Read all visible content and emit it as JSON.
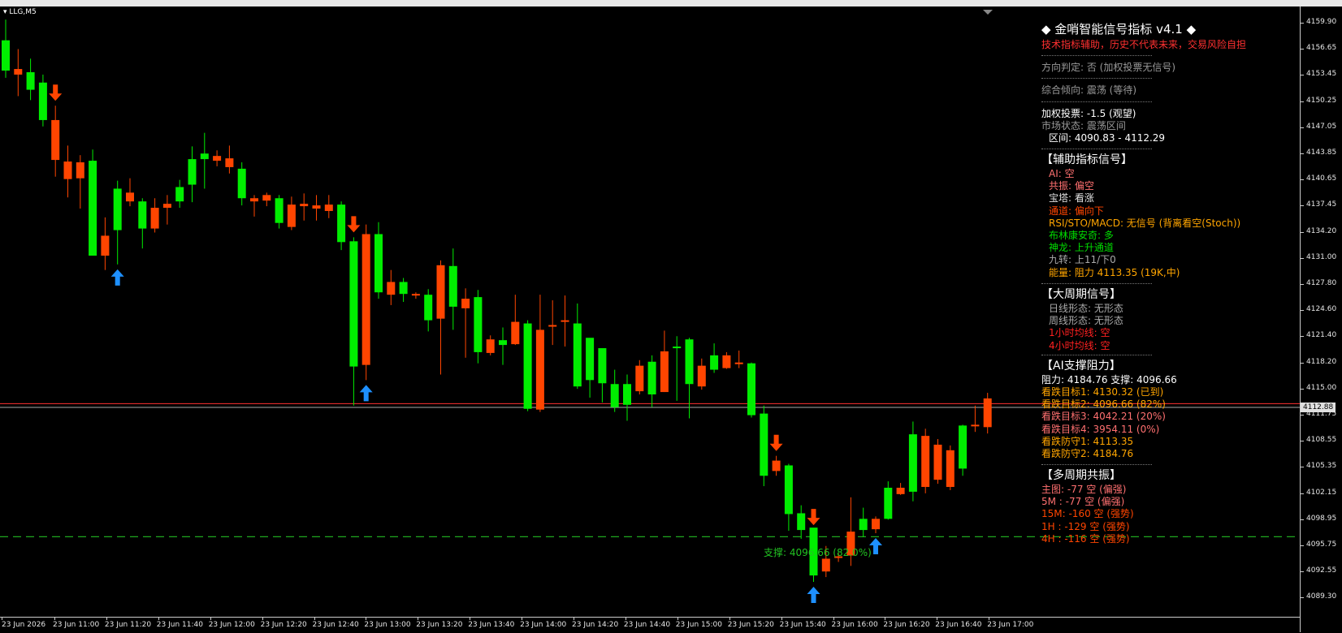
{
  "symbol": "LLG,M5",
  "colors": {
    "bull": "#00ee00",
    "bear": "#ff4500",
    "up_arrow": "#1e90ff",
    "down_arrow": "#ff4500",
    "price_line": "#ff3030",
    "support": "#1fa81f"
  },
  "price_axis": {
    "min": 4089.0,
    "max": 4161.0,
    "labels": [
      "4159.90",
      "4156.65",
      "4153.45",
      "4150.25",
      "4147.05",
      "4143.85",
      "4140.65",
      "4137.45",
      "4134.20",
      "4131.00",
      "4127.80",
      "4124.60",
      "4121.40",
      "4118.20",
      "4115.00",
      "4111.75",
      "4108.55",
      "4105.35",
      "4102.15",
      "4098.95",
      "4095.75",
      "4092.55",
      "4089.30"
    ],
    "current_price": "4112.88"
  },
  "time_axis": {
    "labels": [
      "23 Jun 2026",
      "23 Jun 11:00",
      "23 Jun 11:20",
      "23 Jun 11:40",
      "23 Jun 12:00",
      "23 Jun 12:20",
      "23 Jun 12:40",
      "23 Jun 13:00",
      "23 Jun 13:20",
      "23 Jun 13:40",
      "23 Jun 14:00",
      "23 Jun 14:20",
      "23 Jun 14:40",
      "23 Jun 15:00",
      "23 Jun 15:20",
      "23 Jun 15:40",
      "23 Jun 16:00",
      "23 Jun 16:20",
      "23 Jun 16:40",
      "23 Jun 17:00"
    ]
  },
  "chart_data": {
    "type": "candlestick",
    "candles": [
      {
        "o": 4155.1,
        "h": 4161.5,
        "l": 4154.2,
        "c": 4158.9
      },
      {
        "o": 4155.3,
        "h": 4157.8,
        "l": 4151.9,
        "c": 4154.6
      },
      {
        "o": 4152.7,
        "h": 4156.6,
        "l": 4151.4,
        "c": 4154.9
      },
      {
        "o": 4148.9,
        "h": 4154.6,
        "l": 4148.1,
        "c": 4153.6
      },
      {
        "o": 4148.9,
        "h": 4150.7,
        "l": 4141.8,
        "c": 4143.9
      },
      {
        "o": 4143.7,
        "h": 4145.7,
        "l": 4139.2,
        "c": 4141.5
      },
      {
        "o": 4143.6,
        "h": 4144.5,
        "l": 4137.8,
        "c": 4141.6
      },
      {
        "o": 4131.9,
        "h": 4145.2,
        "l": 4131.9,
        "c": 4143.8
      },
      {
        "o": 4134.4,
        "h": 4136.7,
        "l": 4130.1,
        "c": 4131.9
      },
      {
        "o": 4135.1,
        "h": 4141.3,
        "l": 4130.8,
        "c": 4140.3
      },
      {
        "o": 4139.8,
        "h": 4141.6,
        "l": 4138.1,
        "c": 4138.7
      },
      {
        "o": 4135.3,
        "h": 4139.1,
        "l": 4132.8,
        "c": 4138.7
      },
      {
        "o": 4137.9,
        "h": 4139.1,
        "l": 4134.8,
        "c": 4135.3
      },
      {
        "o": 4138.4,
        "h": 4139.5,
        "l": 4135.8,
        "c": 4137.9
      },
      {
        "o": 4138.7,
        "h": 4141.4,
        "l": 4137.9,
        "c": 4140.5
      },
      {
        "o": 4140.8,
        "h": 4145.6,
        "l": 4138.6,
        "c": 4144.0
      },
      {
        "o": 4144.0,
        "h": 4147.3,
        "l": 4140.3,
        "c": 4144.7
      },
      {
        "o": 4144.4,
        "h": 4145.1,
        "l": 4143.1,
        "c": 4143.8
      },
      {
        "o": 4144.1,
        "h": 4145.7,
        "l": 4142.2,
        "c": 4143.0
      },
      {
        "o": 4139.1,
        "h": 4143.6,
        "l": 4138.2,
        "c": 4142.8
      },
      {
        "o": 4139.1,
        "h": 4139.5,
        "l": 4136.8,
        "c": 4138.7
      },
      {
        "o": 4139.5,
        "h": 4139.8,
        "l": 4138.1,
        "c": 4138.8
      },
      {
        "o": 4136.0,
        "h": 4139.5,
        "l": 4135.3,
        "c": 4139.1
      },
      {
        "o": 4138.3,
        "h": 4139.3,
        "l": 4135.1,
        "c": 4135.5
      },
      {
        "o": 4138.4,
        "h": 4139.7,
        "l": 4136.3,
        "c": 4138.1
      },
      {
        "o": 4138.2,
        "h": 4139.5,
        "l": 4136.3,
        "c": 4137.8
      },
      {
        "o": 4138.3,
        "h": 4139.5,
        "l": 4136.6,
        "c": 4137.5
      },
      {
        "o": 4133.6,
        "h": 4138.7,
        "l": 4132.6,
        "c": 4138.3
      },
      {
        "o": 4118.0,
        "h": 4134.2,
        "l": 4113.1,
        "c": 4133.7
      },
      {
        "o": 4134.6,
        "h": 4135.8,
        "l": 4116.3,
        "c": 4118.2
      },
      {
        "o": 4127.3,
        "h": 4136.1,
        "l": 4126.5,
        "c": 4134.6
      },
      {
        "o": 4128.6,
        "h": 4130.1,
        "l": 4125.7,
        "c": 4127.0
      },
      {
        "o": 4127.1,
        "h": 4129.1,
        "l": 4126.1,
        "c": 4128.6
      },
      {
        "o": 4127.1,
        "h": 4127.3,
        "l": 4126.5,
        "c": 4126.9
      },
      {
        "o": 4123.8,
        "h": 4127.7,
        "l": 4122.4,
        "c": 4127.0
      },
      {
        "o": 4130.7,
        "h": 4131.3,
        "l": 4117.0,
        "c": 4124.0
      },
      {
        "o": 4125.5,
        "h": 4132.8,
        "l": 4122.6,
        "c": 4130.6
      },
      {
        "o": 4126.5,
        "h": 4127.8,
        "l": 4119.1,
        "c": 4125.3
      },
      {
        "o": 4119.8,
        "h": 4127.6,
        "l": 4118.4,
        "c": 4126.7
      },
      {
        "o": 4121.4,
        "h": 4121.9,
        "l": 4119.4,
        "c": 4119.7
      },
      {
        "o": 4120.7,
        "h": 4122.9,
        "l": 4118.2,
        "c": 4121.3
      },
      {
        "o": 4123.6,
        "h": 4127.0,
        "l": 4120.7,
        "c": 4120.8
      },
      {
        "o": 4112.7,
        "h": 4123.8,
        "l": 4112.4,
        "c": 4123.4
      },
      {
        "o": 4122.6,
        "h": 4127.0,
        "l": 4112.3,
        "c": 4112.6
      },
      {
        "o": 4123.2,
        "h": 4126.3,
        "l": 4120.7,
        "c": 4123.1
      },
      {
        "o": 4123.8,
        "h": 4126.9,
        "l": 4120.5,
        "c": 4123.6
      },
      {
        "o": 4115.5,
        "h": 4125.9,
        "l": 4115.2,
        "c": 4123.4
      },
      {
        "o": 4116.3,
        "h": 4120.9,
        "l": 4114.1,
        "c": 4121.6
      },
      {
        "o": 4115.9,
        "h": 4119.4,
        "l": 4113.5,
        "c": 4120.3
      },
      {
        "o": 4112.9,
        "h": 4117.6,
        "l": 4112.3,
        "c": 4115.8
      },
      {
        "o": 4113.2,
        "h": 4117.0,
        "l": 4111.2,
        "c": 4115.8
      },
      {
        "o": 4118.1,
        "h": 4118.8,
        "l": 4114.5,
        "c": 4114.9
      },
      {
        "o": 4114.5,
        "h": 4119.4,
        "l": 4112.9,
        "c": 4118.6
      },
      {
        "o": 4119.9,
        "h": 4122.5,
        "l": 4114.8,
        "c": 4114.8
      },
      {
        "o": 4120.4,
        "h": 4121.8,
        "l": 4113.7,
        "c": 4120.5
      },
      {
        "o": 4115.8,
        "h": 4121.6,
        "l": 4111.5,
        "c": 4121.4
      },
      {
        "o": 4118.1,
        "h": 4119.0,
        "l": 4115.1,
        "c": 4115.5
      },
      {
        "o": 4117.6,
        "h": 4120.9,
        "l": 4117.2,
        "c": 4119.4
      },
      {
        "o": 4119.4,
        "h": 4119.8,
        "l": 4117.7,
        "c": 4117.8
      },
      {
        "o": 4118.5,
        "h": 4120.0,
        "l": 4117.8,
        "c": 4118.4
      },
      {
        "o": 4111.9,
        "h": 4118.5,
        "l": 4111.6,
        "c": 4118.4
      },
      {
        "o": 4104.3,
        "h": 4113.1,
        "l": 4103.0,
        "c": 4112.1
      },
      {
        "o": 4106.2,
        "h": 4106.8,
        "l": 4104.3,
        "c": 4104.9
      },
      {
        "o": 4099.5,
        "h": 4105.8,
        "l": 4097.4,
        "c": 4105.6
      },
      {
        "o": 4097.5,
        "h": 4100.6,
        "l": 4096.4,
        "c": 4099.6
      },
      {
        "o": 4091.8,
        "h": 4097.5,
        "l": 4091.0,
        "c": 4097.8
      },
      {
        "o": 4093.9,
        "h": 4095.5,
        "l": 4091.6,
        "c": 4092.3
      },
      {
        "o": 4094.2,
        "h": 4094.6,
        "l": 4093.5,
        "c": 4094.1
      },
      {
        "o": 4097.3,
        "h": 4101.6,
        "l": 4093.0,
        "c": 4094.3
      },
      {
        "o": 4097.5,
        "h": 4100.3,
        "l": 4096.6,
        "c": 4098.9
      },
      {
        "o": 4098.9,
        "h": 4099.2,
        "l": 4097.1,
        "c": 4097.6
      },
      {
        "o": 4098.9,
        "h": 4103.6,
        "l": 4098.8,
        "c": 4102.8
      },
      {
        "o": 4102.8,
        "h": 4103.4,
        "l": 4101.9,
        "c": 4102.0
      },
      {
        "o": 4102.3,
        "h": 4111.1,
        "l": 4101.1,
        "c": 4109.5
      },
      {
        "o": 4109.3,
        "h": 4110.2,
        "l": 4102.1,
        "c": 4102.9
      },
      {
        "o": 4108.2,
        "h": 4108.9,
        "l": 4103.3,
        "c": 4103.8
      },
      {
        "o": 4107.5,
        "h": 4108.1,
        "l": 4102.5,
        "c": 4102.9
      },
      {
        "o": 4105.2,
        "h": 4110.7,
        "l": 4104.3,
        "c": 4110.6
      },
      {
        "o": 4110.7,
        "h": 4113.1,
        "l": 4109.8,
        "c": 4110.6
      },
      {
        "o": 4114.0,
        "h": 4114.7,
        "l": 4109.6,
        "c": 4110.4
      }
    ],
    "current_price": 4112.88,
    "price_line_2": 4113.35,
    "support_level": 4096.66,
    "down_arrows": [
      4,
      28,
      62,
      65
    ],
    "up_arrows": [
      9,
      29,
      65,
      70
    ],
    "ylim": [
      4089.0,
      4161.0
    ]
  },
  "support_label": "支撑: 4096.66 (82.0%)",
  "panel": {
    "title": "◆ 金哨智能信号指标 v4.1 ◆",
    "disclaimer": "技术指标辅助，历史不代表未来，交易风险自担",
    "direction": "方向判定: 否 (加权投票无信号)",
    "tendency": "综合倾向: 震荡 (等待)",
    "vote": "加权投票: -1.5 (观望)",
    "market": "市场状态: 震荡区间",
    "range": "区间: 4090.83 - 4112.29",
    "aux_header": "【辅助指标信号】",
    "aux": [
      {
        "text": "AI: 空",
        "color": "#ff7070"
      },
      {
        "text": "共振: 偏空",
        "color": "#ff7070"
      },
      {
        "text": "宝塔: 看涨",
        "color": "#e0e0e0"
      },
      {
        "text": "通道: 偏向下",
        "color": "#ff4500"
      },
      {
        "text": "RSI/STO/MACD: 无信号 (背离看空(Stoch))",
        "color": "#ffa500"
      },
      {
        "text": "布林康安奇: 多",
        "color": "#00dd00"
      },
      {
        "text": "神龙: 上升通道",
        "color": "#00dd00"
      },
      {
        "text": "九转: 上11/下0",
        "color": "#aaaaaa"
      },
      {
        "text": "能量: 阻力 4113.35 (19K,中)",
        "color": "#ffa500"
      }
    ],
    "big_header": "【大周期信号】",
    "big": [
      {
        "text": "日线形态: 无形态",
        "color": "#aaaaaa"
      },
      {
        "text": "周线形态: 无形态",
        "color": "#aaaaaa"
      },
      {
        "text": "1小时均线: 空",
        "color": "#ff2020"
      },
      {
        "text": "4小时均线: 空",
        "color": "#ff2020"
      }
    ],
    "sr_header": "【AI支撑阻力】",
    "sr_line": "阻力: 4184.76   支撑: 4096.66",
    "targets": [
      {
        "text": "看跌目标1: 4130.32 (已到)",
        "color": "#ffa500"
      },
      {
        "text": "看跌目标2: 4096.66 (82%)",
        "color": "#ffa500"
      },
      {
        "text": "看跌目标3: 4042.21 (20%)",
        "color": "#ff7070"
      },
      {
        "text": "看跌目标4: 3954.11 (0%)",
        "color": "#ff7070"
      },
      {
        "text": "看跌防守1: 4113.35",
        "color": "#ffa500"
      },
      {
        "text": "看跌防守2: 4184.76",
        "color": "#ffa500"
      }
    ],
    "multi_header": "【多周期共振】",
    "multi": [
      {
        "text": "主图: -77 空 (偏强)",
        "color": "#ff7070"
      },
      {
        "text": "5M : -77 空 (偏强)",
        "color": "#ff7070"
      },
      {
        "text": "15M: -160 空 (强势)",
        "color": "#ff4500"
      },
      {
        "text": "1H : -129 空 (强势)",
        "color": "#ff4500"
      },
      {
        "text": "4H : -116 空 (强势)",
        "color": "#ff4500"
      }
    ]
  }
}
